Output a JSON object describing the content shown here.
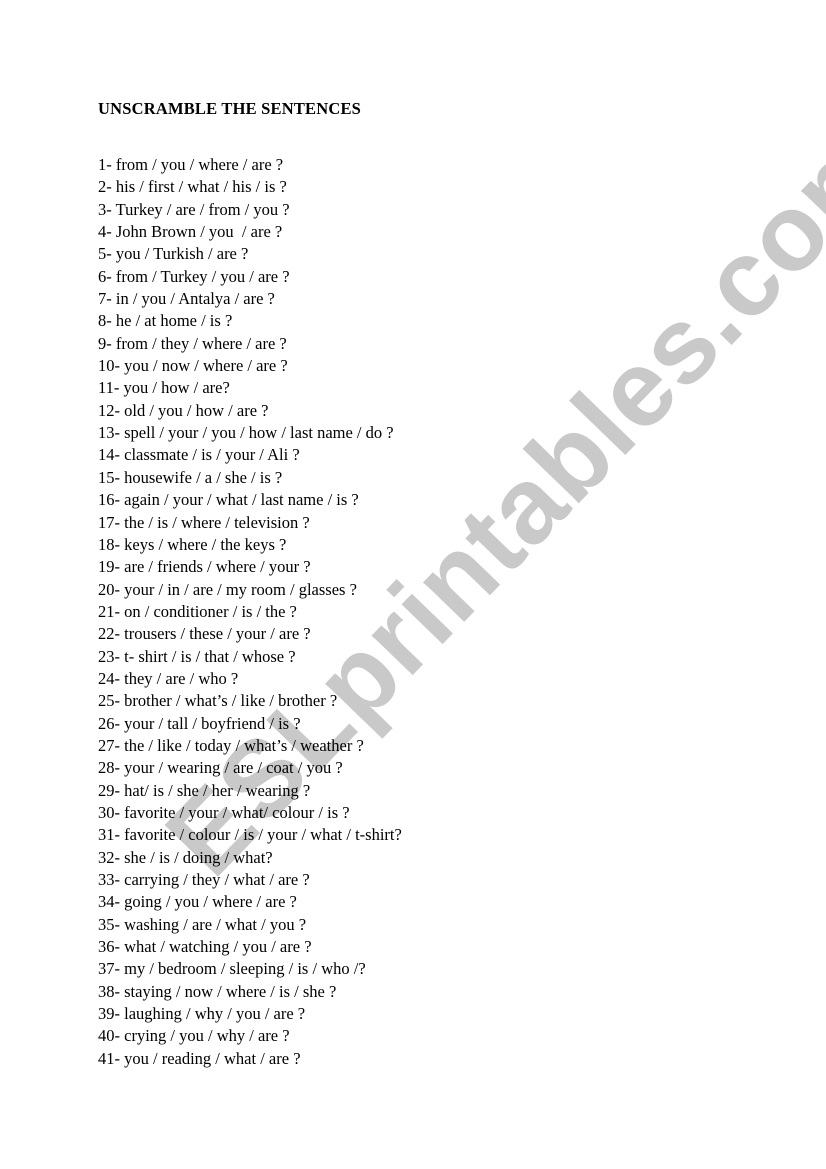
{
  "document": {
    "title": "UNSCRAMBLE THE SENTENCES",
    "watermark": "ESLprintables.com",
    "items": [
      {
        "number": "1-",
        "text": "from / you / where / are ?"
      },
      {
        "number": "2-",
        "text": "his / first / what / his / is ?"
      },
      {
        "number": "3-",
        "text": "Turkey / are / from / you ?"
      },
      {
        "number": "4-",
        "text": "John Brown / you  / are ?"
      },
      {
        "number": "5-",
        "text": "you / Turkish / are ?"
      },
      {
        "number": "6-",
        "text": "from / Turkey / you / are ?"
      },
      {
        "number": "7-",
        "text": "in / you / Antalya / are ?"
      },
      {
        "number": "8-",
        "text": "he / at home / is ?"
      },
      {
        "number": "9-",
        "text": "from / they / where / are ?"
      },
      {
        "number": "10-",
        "text": "you / now / where / are ?"
      },
      {
        "number": "11-",
        "text": "you / how / are?"
      },
      {
        "number": "12-",
        "text": "old / you / how / are ?"
      },
      {
        "number": "13-",
        "text": "spell / your / you / how / last name / do ?"
      },
      {
        "number": "14-",
        "text": "classmate / is / your / Ali ?"
      },
      {
        "number": "15-",
        "text": "housewife / a / she / is ?"
      },
      {
        "number": "16-",
        "text": "again / your / what / last name / is ?"
      },
      {
        "number": "17-",
        "text": "the / is / where / television ?"
      },
      {
        "number": "18-",
        "text": "keys / where / the keys ?"
      },
      {
        "number": "19-",
        "text": "are / friends / where / your ?"
      },
      {
        "number": "20-",
        "text": "your / in / are / my room / glasses ?"
      },
      {
        "number": "21-",
        "text": "on / conditioner / is / the ?"
      },
      {
        "number": "22-",
        "text": "trousers / these / your / are ?"
      },
      {
        "number": "23-",
        "text": "t- shirt / is / that / whose ?"
      },
      {
        "number": "24-",
        "text": "they / are / who ?"
      },
      {
        "number": "25-",
        "text": "brother / what’s / like / brother ?"
      },
      {
        "number": "26-",
        "text": "your / tall / boyfriend / is ?"
      },
      {
        "number": "27-",
        "text": "the / like / today / what’s / weather ?"
      },
      {
        "number": "28-",
        "text": "your / wearing / are / coat / you ?"
      },
      {
        "number": "29-",
        "text": "hat/ is / she / her / wearing ?"
      },
      {
        "number": "30-",
        "text": "favorite / your / what/ colour / is ?"
      },
      {
        "number": "31-",
        "text": "favorite / colour / is / your / what / t-shirt?"
      },
      {
        "number": "32-",
        "text": "she / is / doing / what?"
      },
      {
        "number": "33-",
        "text": "carrying / they / what / are ?"
      },
      {
        "number": "34-",
        "text": "going / you / where / are ?"
      },
      {
        "number": "35-",
        "text": "washing / are / what / you ?"
      },
      {
        "number": "36-",
        "text": "what / watching / you / are ?"
      },
      {
        "number": "37-",
        "text": "my / bedroom / sleeping / is / who /?"
      },
      {
        "number": "38-",
        "text": "staying / now / where / is / she ?"
      },
      {
        "number": "39-",
        "text": "laughing / why / you / are ?"
      },
      {
        "number": "40-",
        "text": "crying / you / why / are ?"
      },
      {
        "number": "41-",
        "text": "you / reading / what / are ?"
      }
    ]
  },
  "colors": {
    "text": "#000000",
    "watermark": "#c9c9c9",
    "background": "#ffffff"
  }
}
